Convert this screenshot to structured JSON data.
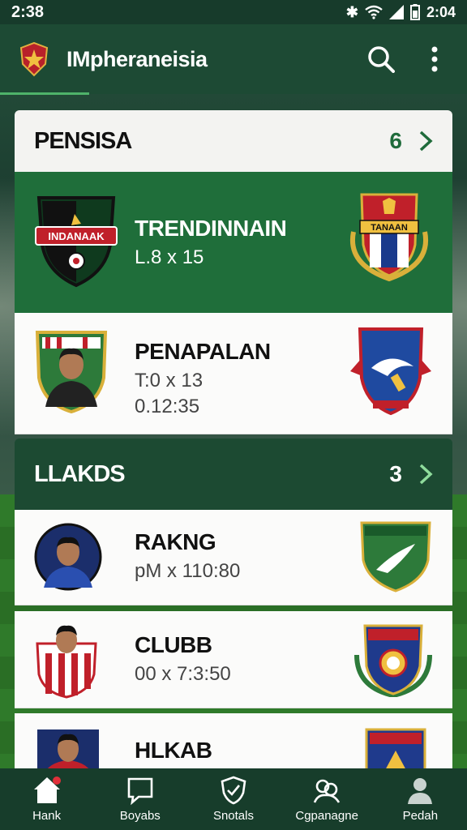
{
  "status": {
    "left_time": "2:38",
    "right_time": "2:04"
  },
  "appbar": {
    "title": "IMpheraneisia"
  },
  "sections": [
    {
      "name": "PENSISA",
      "count": "6"
    },
    {
      "name": "LLAKDS",
      "count": "3"
    }
  ],
  "rows": [
    {
      "name": "TRENDINNAIN",
      "sub1": "L.8 x 15",
      "crest_left_text": "INDANAAK",
      "crest_right_text": "TANAAN"
    },
    {
      "name": "PENAPALAN",
      "sub1": "T:0 x 13",
      "sub2": "0.12:35"
    },
    {
      "name": "RAKNG",
      "sub1": "pM x 110:80"
    },
    {
      "name": "CLUBB",
      "sub1": "00 x 7:3:50"
    },
    {
      "name": "HLKAB"
    }
  ],
  "bottom_nav": [
    {
      "label": "Hank",
      "icon": "home-icon"
    },
    {
      "label": "Boyabs",
      "icon": "chat-icon"
    },
    {
      "label": "Snotals",
      "icon": "shield-icon"
    },
    {
      "label": "Cgpanagne",
      "icon": "people-icon"
    },
    {
      "label": "Pedah",
      "icon": "profile-icon"
    }
  ],
  "colors": {
    "accent": "#1f6e3a",
    "header_dark": "#1d4a34",
    "nav_bg": "#173d2b"
  }
}
